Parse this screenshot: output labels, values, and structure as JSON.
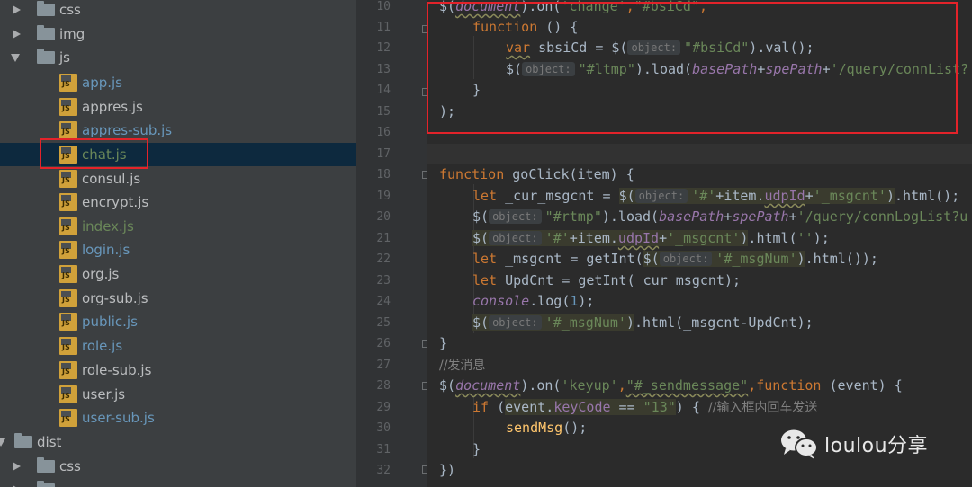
{
  "tree": {
    "items": [
      {
        "label": "css",
        "kind": "folder",
        "expanded": false
      },
      {
        "label": "img",
        "kind": "folder",
        "expanded": false
      },
      {
        "label": "js",
        "kind": "folder",
        "expanded": true
      },
      {
        "label": "app.js",
        "kind": "file"
      },
      {
        "label": "appres.js",
        "kind": "file"
      },
      {
        "label": "appres-sub.js",
        "kind": "file"
      },
      {
        "label": "chat.js",
        "kind": "file",
        "selected": true
      },
      {
        "label": "consul.js",
        "kind": "file"
      },
      {
        "label": "encrypt.js",
        "kind": "file"
      },
      {
        "label": "index.js",
        "kind": "file"
      },
      {
        "label": "login.js",
        "kind": "file"
      },
      {
        "label": "org.js",
        "kind": "file"
      },
      {
        "label": "org-sub.js",
        "kind": "file"
      },
      {
        "label": "public.js",
        "kind": "file"
      },
      {
        "label": "role.js",
        "kind": "file"
      },
      {
        "label": "role-sub.js",
        "kind": "file"
      },
      {
        "label": "user.js",
        "kind": "file"
      },
      {
        "label": "user-sub.js",
        "kind": "file"
      },
      {
        "label": "dist",
        "kind": "folder",
        "expanded": true
      },
      {
        "label": "css",
        "kind": "folder",
        "expanded": false
      }
    ]
  },
  "editor": {
    "line_numbers": [
      "10",
      "11",
      "12",
      "13",
      "14",
      "15",
      "16",
      "17",
      "18",
      "19",
      "20",
      "21",
      "22",
      "23",
      "24",
      "25",
      "26",
      "27",
      "28",
      "29",
      "30",
      "31",
      "32"
    ],
    "hint_object": "object:",
    "l10": {
      "a": "$(",
      "b": "document",
      "c": ").on(",
      "d": "'change'",
      "e": ",",
      "f": "\"#bsiCd\"",
      "g": ","
    },
    "l11": {
      "a": "function",
      "b": " () {"
    },
    "l12": {
      "a": "var",
      "b": " sbsiCd = $(",
      "c": "\"#bsiCd\"",
      "d": ").val();"
    },
    "l13": {
      "a": "$(",
      "b": "\"#ltmp\"",
      "c": ").load(",
      "d": "basePath",
      "e": "+",
      "f": "spePath",
      "g": "+",
      "h": "'/query/connList?"
    },
    "l14": "}",
    "l15": ");",
    "l18": {
      "a": "function",
      "b": " ",
      "c": "goClick",
      "d": "(item) {"
    },
    "l19": {
      "a": "let",
      "b": " _cur_msgcnt = ",
      "c": "$(",
      "d": "'#'",
      "e": "+item.",
      "f": "udpId",
      "g": "+",
      "h": "'_msgcnt'",
      "i": ")",
      "j": ".html();"
    },
    "l20": {
      "a": "$(",
      "b": "\"#rtmp\"",
      "c": ").load(",
      "d": "basePath",
      "e": "+",
      "f": "spePath",
      "g": "+",
      "h": "'/query/connLogList?u"
    },
    "l21": {
      "a": "$(",
      "b": "'#'",
      "c": "+item.",
      "d": "udpId",
      "e": "+",
      "f": "'_msgcnt'",
      "g": ")",
      "h": ".html(",
      "i": "''",
      "j": ");"
    },
    "l22": {
      "a": "let",
      "b": " _msgcnt = getInt(",
      "c": "$(",
      "d": "'#_msgNum'",
      "e": ")",
      "f": ".html());"
    },
    "l23": {
      "a": "let",
      "b": " UpdCnt = getInt(_cur_msgcnt);"
    },
    "l24": {
      "a": "console",
      "b": ".log(",
      "c": "1",
      "d": ");"
    },
    "l25": {
      "a": "$(",
      "b": "'#_msgNum'",
      "c": ")",
      "d": ".html(_msgcnt-UpdCnt);"
    },
    "l26": "}",
    "l27": "//发消息",
    "l28": {
      "a": "$(",
      "b": "document",
      "c": ").on(",
      "d": "'keyup'",
      "e": ",",
      "f": "\"#_sendmessage\"",
      "g": ",",
      "h": "function",
      "i": " (event) {"
    },
    "l29": {
      "a": "if",
      "b": " (",
      "c": "event.",
      "d": "keyCode",
      "e": " == ",
      "f": "\"13\"",
      "g": ") { ",
      "h": "//输入框内回车发送"
    },
    "l30": {
      "a": "sendMsg",
      "b": "();"
    },
    "l31": "}",
    "l32": "})"
  },
  "watermark": {
    "text": "loulou分享",
    "icon": "wechat-icon"
  },
  "colors": {
    "highlight_border": "#e3232a",
    "tree_bg": "#3c3f41",
    "editor_bg": "#2b2b2b"
  }
}
